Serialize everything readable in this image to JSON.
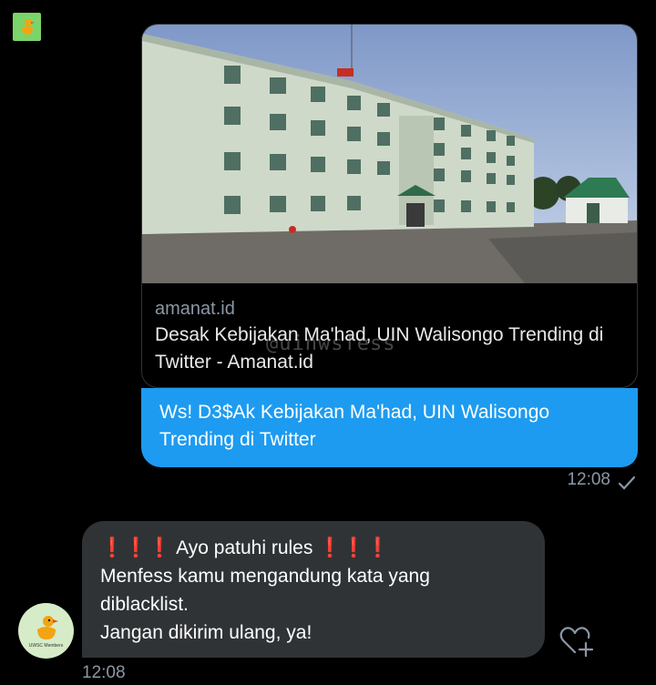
{
  "link_card": {
    "domain": "amanat.id",
    "title": "Desak Kebijakan Ma'had, UIN Walisongo Trending di Twitter - Amanat.id",
    "watermark": "@uinwsfess"
  },
  "sent_message": {
    "text": "Ws! D3$Ak Kebijakan Ma'had, UIN Walisongo Trending di Twitter",
    "time": "12:08",
    "status_icon": "check-icon"
  },
  "received_message": {
    "line1": "Ayo patuhi rules",
    "line2": "Menfess kamu mengandung kata yang",
    "line3": "diblacklist.",
    "line4": "Jangan dikirim ulang, ya!",
    "time": "12:08",
    "emoji_marks": "❗❗❗"
  },
  "bot_avatar_label": "UWSC Members",
  "colors": {
    "sent_bubble": "#1d9bf0",
    "received_bubble": "#2f3336",
    "background": "#000000",
    "timestamp": "#8b98a5"
  }
}
